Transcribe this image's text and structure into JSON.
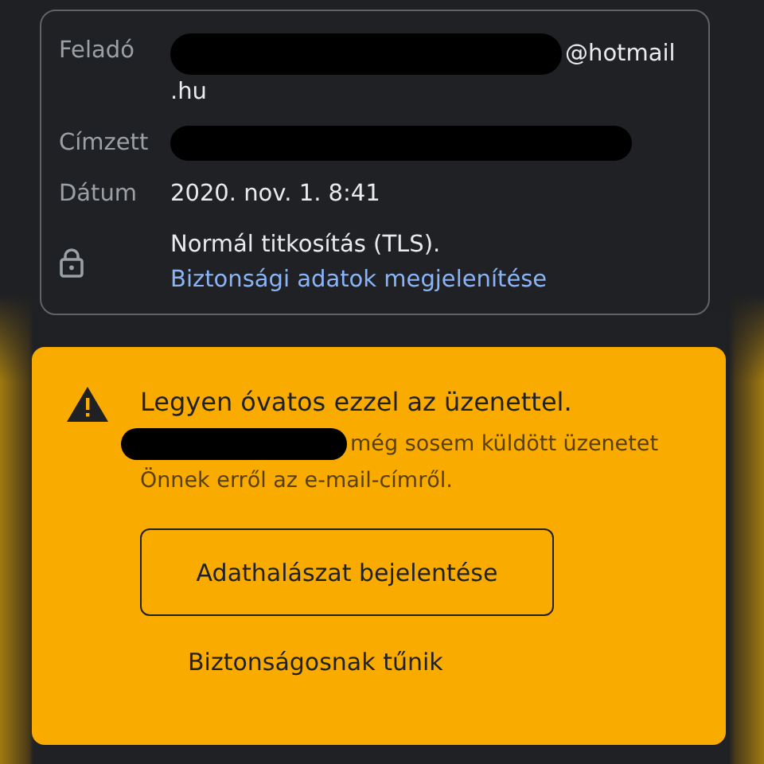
{
  "details": {
    "rows": [
      {
        "kind": "field",
        "label": "Feladó",
        "redacted": true,
        "lines": [
          "@hotmail",
          ".hu"
        ]
      },
      {
        "kind": "field",
        "label": "Címzett",
        "redacted": true,
        "lines": []
      },
      {
        "kind": "field",
        "label": "Dátum",
        "redacted": false,
        "lines": [
          "2020. nov. 1. 8:41"
        ]
      },
      {
        "kind": "security",
        "text": "Normál titkosítás (TLS).",
        "link": "Biztonsági adatok megjelenítése"
      }
    ]
  },
  "warning": {
    "title": "Legyen óvatos ezzel az üzenettel.",
    "sender_redacted": true,
    "body": "még sosem küldött üzenetet Önnek erről az e-mail-címről.",
    "primary_button": "Adathalászat bejelentése",
    "secondary_button": "Biztonságosnak tűnik"
  }
}
